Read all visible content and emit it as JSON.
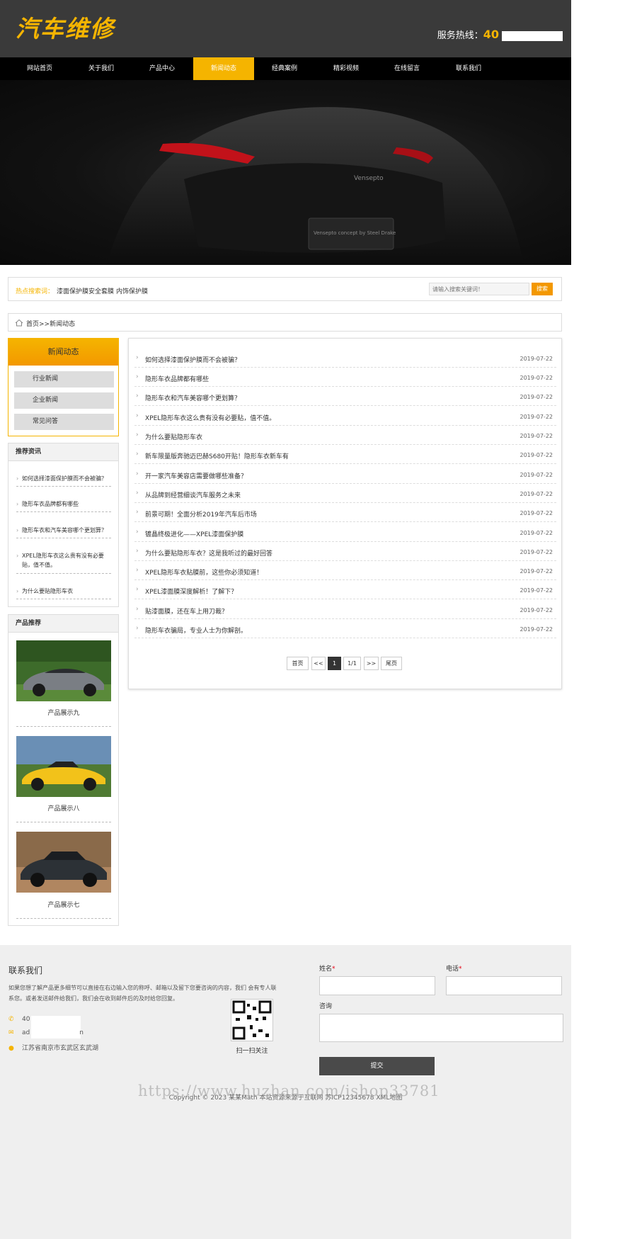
{
  "header": {
    "logo": "汽车维修",
    "hotline_label": "服务热线：",
    "hotline_number": "40"
  },
  "nav": [
    {
      "label": "网站首页"
    },
    {
      "label": "关于我们"
    },
    {
      "label": "产品中心"
    },
    {
      "label": "新闻动态",
      "active": true
    },
    {
      "label": "经典案例"
    },
    {
      "label": "精彩视频"
    },
    {
      "label": "在线留言"
    },
    {
      "label": "联系我们"
    }
  ],
  "banner": {
    "brand": "Vensepto",
    "plate": "Vensepto concept by Steel Drake"
  },
  "hot_search": {
    "label": "热点搜索词：",
    "keywords": [
      "漆面保护膜",
      "安全套膜",
      "内饰保护膜"
    ],
    "placeholder": "请输入搜索关键词！",
    "button": "搜索"
  },
  "breadcrumb": "首页>>新闻动态",
  "sidebar": {
    "news_title": "新闻动态",
    "categories": [
      "行业新闻",
      "企业新闻",
      "常见问答"
    ],
    "rec_title": "推荐资讯",
    "rec_items": [
      "如何选择漆面保护膜而不会被骗？",
      "隐形车衣品牌都有哪些",
      "隐形车衣和汽车美容哪个更划算？",
      "XPEL隐形车衣这么贵有没有必要贴，值不值。",
      "为什么要贴隐形车衣"
    ],
    "prod_title": "产品推荐",
    "products": [
      "产品展示九",
      "产品展示八",
      "产品展示七"
    ]
  },
  "news": [
    {
      "title": "如何选择漆面保护膜而不会被骗？",
      "date": "2019-07-22"
    },
    {
      "title": "隐形车衣品牌都有哪些",
      "date": "2019-07-22"
    },
    {
      "title": "隐形车衣和汽车美容哪个更划算？",
      "date": "2019-07-22"
    },
    {
      "title": "XPEL隐形车衣这么贵有没有必要贴，值不值。",
      "date": "2019-07-22"
    },
    {
      "title": "为什么要贴隐形车衣",
      "date": "2019-07-22"
    },
    {
      "title": "新车限量版奔驰迈巴赫S680开贴！隐形车衣新车有",
      "date": "2019-07-22"
    },
    {
      "title": "开一家汽车美容店需要做哪些准备？",
      "date": "2019-07-22"
    },
    {
      "title": "从品牌到经营细谈汽车服务之未来",
      "date": "2019-07-22"
    },
    {
      "title": "前景可期！全面分析2019年汽车后市场",
      "date": "2019-07-22"
    },
    {
      "title": "镀晶终极进化——XPEL漆面保护膜",
      "date": "2019-07-22"
    },
    {
      "title": "为什么要贴隐形车衣？这是我听过的最好回答",
      "date": "2019-07-22"
    },
    {
      "title": "XPEL隐形车衣贴膜前，这些你必须知道！",
      "date": "2019-07-22"
    },
    {
      "title": "XPEL漆面膜深度解析！了解下？",
      "date": "2019-07-22"
    },
    {
      "title": "贴漆面膜，还在车上用刀裁？",
      "date": "2019-07-22"
    },
    {
      "title": "隐形车衣骗局，专业人士为你解剖。",
      "date": "2019-07-22"
    }
  ],
  "pagination": {
    "first": "首页",
    "prev": "<<",
    "current": "1",
    "total": "1/1",
    "next": ">>",
    "last": "尾页"
  },
  "footer": {
    "contact_title": "联系我们",
    "contact_desc": "如果您想了解产品更多细节可以直接在右边输入您的称呼、邮箱以及留下您要咨询的内容，我们 会有专人联系您。或者发送邮件给我们，我们会在收到邮件后的及时给您回复。",
    "phone": "40",
    "email": "ad",
    "email_tail": "n",
    "address": "江苏省南京市玄武区玄武湖",
    "qr_label": "扫一扫关注",
    "form": {
      "name_label": "姓名",
      "phone_label": "电话",
      "consult_label": "咨询",
      "required_mark": "*",
      "submit": "提交"
    },
    "copyright": "Copyright © 2023 某某Math 本站资源来源于互联网 苏ICP12345678 XML地图",
    "watermark": "https://www.huzhan.com/ishop33781"
  }
}
